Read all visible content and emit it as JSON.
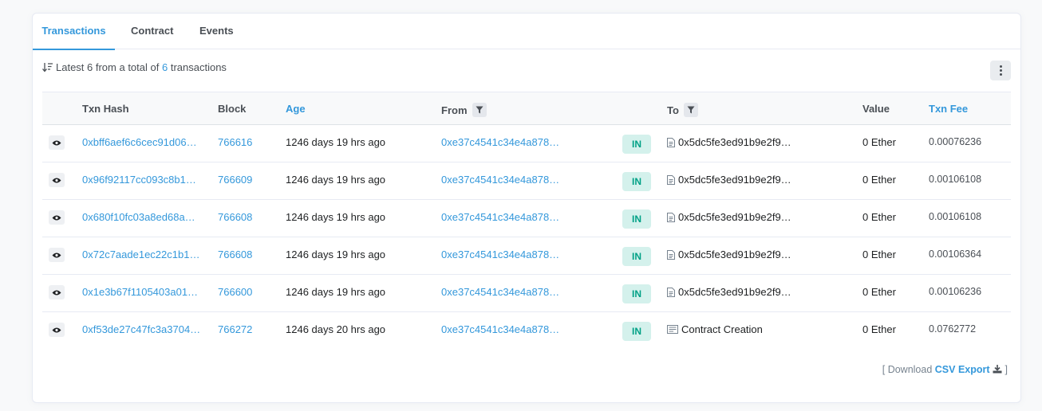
{
  "tabs": [
    {
      "label": "Transactions",
      "active": true
    },
    {
      "label": "Contract",
      "active": false
    },
    {
      "label": "Events",
      "active": false
    }
  ],
  "summary": {
    "prefix": "Latest 6 from a total of",
    "count": "6",
    "suffix": "transactions"
  },
  "columns": {
    "txn_hash": "Txn Hash",
    "block": "Block",
    "age": "Age",
    "from": "From",
    "to": "To",
    "value": "Value",
    "txn_fee": "Txn Fee"
  },
  "rows": [
    {
      "hash": "0xbff6aef6c6cec91d06…",
      "block": "766616",
      "age": "1246 days 19 hrs ago",
      "from": "0xe37c4541c34e4a878…",
      "direction": "IN",
      "to": "0x5dc5fe3ed91b9e2f9…",
      "to_type": "contract",
      "value": "0 Ether",
      "fee": "0.00076236"
    },
    {
      "hash": "0x96f92117cc093c8b1…",
      "block": "766609",
      "age": "1246 days 19 hrs ago",
      "from": "0xe37c4541c34e4a878…",
      "direction": "IN",
      "to": "0x5dc5fe3ed91b9e2f9…",
      "to_type": "contract",
      "value": "0 Ether",
      "fee": "0.00106108"
    },
    {
      "hash": "0x680f10fc03a8ed68a…",
      "block": "766608",
      "age": "1246 days 19 hrs ago",
      "from": "0xe37c4541c34e4a878…",
      "direction": "IN",
      "to": "0x5dc5fe3ed91b9e2f9…",
      "to_type": "contract",
      "value": "0 Ether",
      "fee": "0.00106108"
    },
    {
      "hash": "0x72c7aade1ec22c1b1…",
      "block": "766608",
      "age": "1246 days 19 hrs ago",
      "from": "0xe37c4541c34e4a878…",
      "direction": "IN",
      "to": "0x5dc5fe3ed91b9e2f9…",
      "to_type": "contract",
      "value": "0 Ether",
      "fee": "0.00106364"
    },
    {
      "hash": "0x1e3b67f1105403a01…",
      "block": "766600",
      "age": "1246 days 19 hrs ago",
      "from": "0xe37c4541c34e4a878…",
      "direction": "IN",
      "to": "0x5dc5fe3ed91b9e2f9…",
      "to_type": "contract",
      "value": "0 Ether",
      "fee": "0.00106236"
    },
    {
      "hash": "0xf53de27c47fc3a3704…",
      "block": "766272",
      "age": "1246 days 20 hrs ago",
      "from": "0xe37c4541c34e4a878…",
      "direction": "IN",
      "to": "Contract Creation",
      "to_type": "creation",
      "value": "0 Ether",
      "fee": "0.0762772"
    }
  ],
  "footer": {
    "open": "[ Download",
    "link": "CSV Export",
    "close": "]"
  },
  "colors": {
    "accent": "#3498db",
    "in_badge_bg": "#d4f1ec",
    "in_badge_text": "#00a186"
  }
}
